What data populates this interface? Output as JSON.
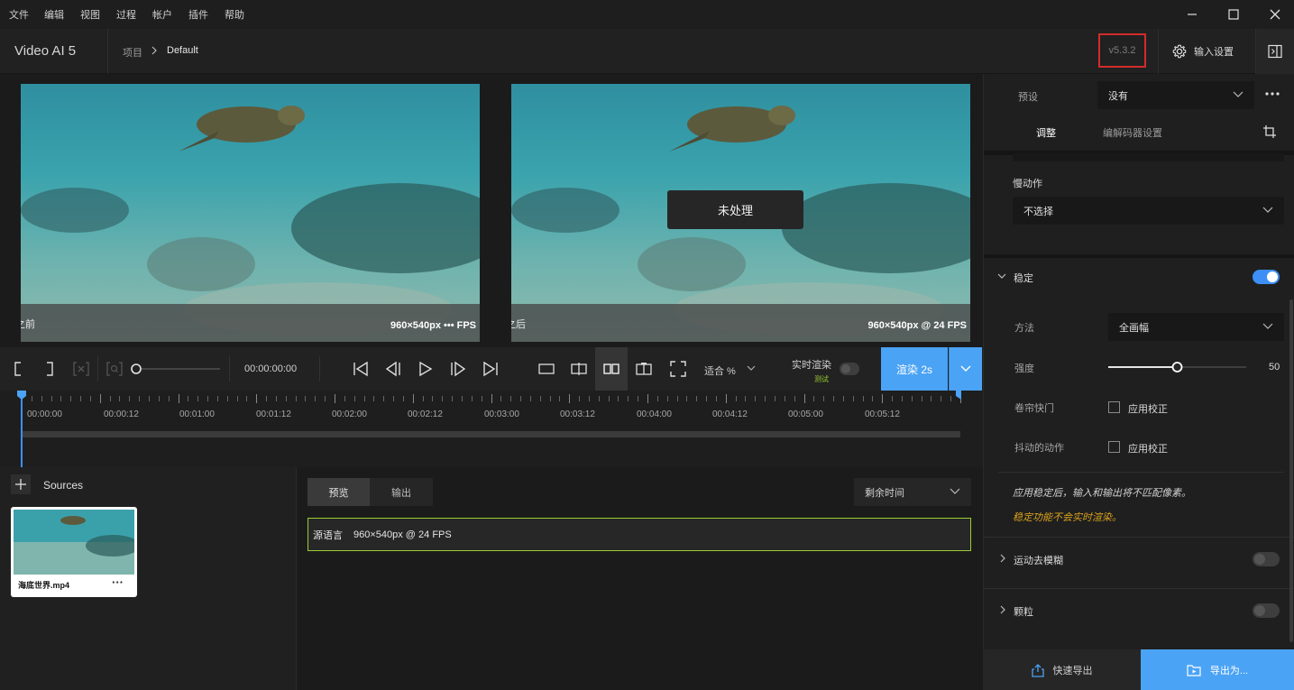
{
  "menu": [
    "文件",
    "编辑",
    "视图",
    "过程",
    "帐户",
    "插件",
    "帮助"
  ],
  "header": {
    "app_title": "Video AI  5",
    "breadcrumb_project": "项目",
    "breadcrumb_current": "Default",
    "version": "v5.3.2",
    "input_settings": "输入设置"
  },
  "preview": {
    "before_label": "之前",
    "before_info": "960×540px ••• FPS",
    "after_label": "之后",
    "after_info": "960×540px @ 24 FPS",
    "overlay": "未处理"
  },
  "transport": {
    "timecode": "00:00:00:00",
    "fit": "适合  %",
    "realtime": "实时渲染",
    "realtime_badge": "测试",
    "render": "渲染 2s"
  },
  "timeline": {
    "labels": [
      "00:00:00",
      "00:00:12",
      "00:01:00",
      "00:01:12",
      "00:02:00",
      "00:02:12",
      "00:03:00",
      "00:03:12",
      "00:04:00",
      "00:04:12",
      "00:05:00",
      "00:05:12"
    ]
  },
  "sources": {
    "title": "Sources",
    "clip_name": "海底世界.mp4",
    "clip_more": "···"
  },
  "queue": {
    "tab_preview": "预览",
    "tab_output": "输出",
    "sort": "剩余时间",
    "job_label": "源语言",
    "job_info": "960×540px @ 24 FPS"
  },
  "panel": {
    "preset_label": "预设",
    "preset_value": "没有",
    "tab_adjust": "调整",
    "tab_codec": "编解码器设置",
    "slowmo_label": "慢动作",
    "slowmo_value": "不选择",
    "stabilize_title": "稳定",
    "method_label": "方法",
    "method_value": "全画幅",
    "strength_label": "强度",
    "strength_value": "50",
    "strength_fraction": 0.5,
    "rolling_label": "卷帘快门",
    "rolling_check": "应用校正",
    "jitter_label": "抖动的动作",
    "jitter_check": "应用校正",
    "note1": "应用稳定后，输入和输出将不匹配像素。",
    "note2": "稳定功能不会实时渲染。",
    "motion_deblur": "运动去模糊",
    "grain": "颗粒"
  },
  "footer": {
    "quick_export": "快速导出",
    "export_as": "导出为..."
  },
  "colors": {
    "accent": "#4ba3f5",
    "note_warning": "#d9a21b",
    "job_border": "#9acd32",
    "version_box": "#d42b2b"
  }
}
